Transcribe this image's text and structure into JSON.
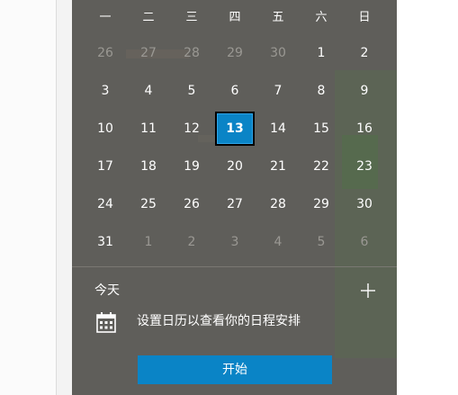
{
  "calendar": {
    "weekdays": [
      "一",
      "二",
      "三",
      "四",
      "五",
      "六",
      "日"
    ],
    "weeks": [
      [
        {
          "d": "26",
          "m": true
        },
        {
          "d": "27",
          "m": true
        },
        {
          "d": "28",
          "m": true
        },
        {
          "d": "29",
          "m": true
        },
        {
          "d": "30",
          "m": true
        },
        {
          "d": "1",
          "m": false
        },
        {
          "d": "2",
          "m": false
        }
      ],
      [
        {
          "d": "3",
          "m": false
        },
        {
          "d": "4",
          "m": false
        },
        {
          "d": "5",
          "m": false
        },
        {
          "d": "6",
          "m": false
        },
        {
          "d": "7",
          "m": false
        },
        {
          "d": "8",
          "m": false
        },
        {
          "d": "9",
          "m": false
        }
      ],
      [
        {
          "d": "10",
          "m": false
        },
        {
          "d": "11",
          "m": false
        },
        {
          "d": "12",
          "m": false
        },
        {
          "d": "13",
          "m": false,
          "today": true
        },
        {
          "d": "14",
          "m": false
        },
        {
          "d": "15",
          "m": false
        },
        {
          "d": "16",
          "m": false
        }
      ],
      [
        {
          "d": "17",
          "m": false
        },
        {
          "d": "18",
          "m": false
        },
        {
          "d": "19",
          "m": false
        },
        {
          "d": "20",
          "m": false
        },
        {
          "d": "21",
          "m": false
        },
        {
          "d": "22",
          "m": false
        },
        {
          "d": "23",
          "m": false
        }
      ],
      [
        {
          "d": "24",
          "m": false
        },
        {
          "d": "25",
          "m": false
        },
        {
          "d": "26",
          "m": false
        },
        {
          "d": "27",
          "m": false
        },
        {
          "d": "28",
          "m": false
        },
        {
          "d": "29",
          "m": false
        },
        {
          "d": "30",
          "m": false
        }
      ],
      [
        {
          "d": "31",
          "m": false
        },
        {
          "d": "1",
          "m": true
        },
        {
          "d": "2",
          "m": true
        },
        {
          "d": "3",
          "m": true
        },
        {
          "d": "4",
          "m": true
        },
        {
          "d": "5",
          "m": true
        },
        {
          "d": "6",
          "m": true
        }
      ]
    ]
  },
  "agenda": {
    "today_label": "今天",
    "add_icon": "plus-icon",
    "calendar_icon": "calendar-icon",
    "setup_text": "设置日历以查看你的日程安排",
    "start_label": "开始"
  },
  "colors": {
    "flyout_bg": "#5f5e5a",
    "accent": "#0a84c6",
    "muted_text": "#9a9893"
  }
}
